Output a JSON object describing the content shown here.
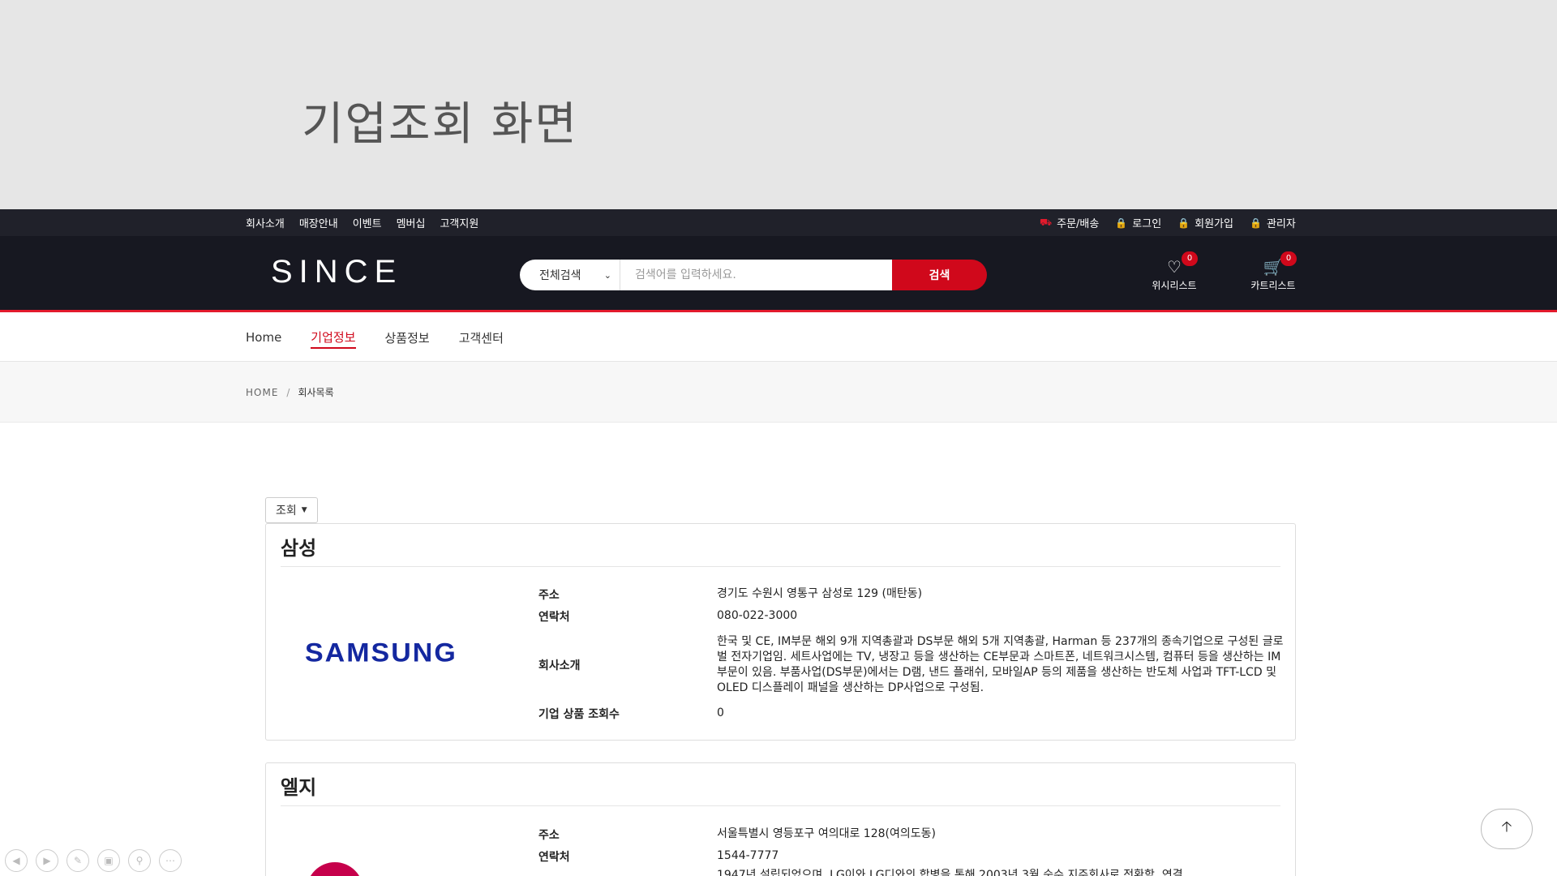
{
  "slide": {
    "title": "기업조회 화면"
  },
  "topbar": {
    "left_links": [
      "회사소개",
      "매장안내",
      "이벤트",
      "멤버십",
      "고객지원"
    ],
    "right_links": [
      {
        "label": "주문/배송",
        "icon": "truck-icon"
      },
      {
        "label": "로그인",
        "icon": "lock-icon"
      },
      {
        "label": "회원가입",
        "icon": "lock-icon"
      },
      {
        "label": "관리자",
        "icon": "lock-icon"
      }
    ]
  },
  "header": {
    "logo": "SINCE",
    "search": {
      "category": "전체검색",
      "placeholder": "검색어를 입력하세요.",
      "button": "검색"
    },
    "wishlist": {
      "label": "위시리스트",
      "count": "0",
      "icon": "heart-icon"
    },
    "cart": {
      "label": "카트리스트",
      "count": "0",
      "icon": "cart-icon"
    }
  },
  "mainnav": {
    "items": [
      "Home",
      "기업정보",
      "상품정보",
      "고객센터"
    ],
    "active": "기업정보"
  },
  "breadcrumb": {
    "home": "HOME",
    "sep": "/",
    "current": "회사목록"
  },
  "dropdown": {
    "label": "조회"
  },
  "companies": [
    {
      "name": "삼성",
      "logo_text": "SAMSUNG",
      "address_label": "주소",
      "address": "경기도 수원시 영통구 삼성로 129 (매탄동)",
      "phone_label": "연락처",
      "phone": "080-022-3000",
      "intro_label": "회사소개",
      "intro": "한국 및 CE, IM부문 해외 9개 지역총괄과 DS부문 해외 5개 지역총괄, Harman 등 237개의 종속기업으로 구성된 글로벌 전자기업임. 세트사업에는 TV, 냉장고 등을 생산하는 CE부문과 스마트폰, 네트워크시스템, 컴퓨터 등을 생산하는 IM부문이 있음. 부품사업(DS부문)에서는 D램, 낸드 플래쉬, 모바일AP 등의 제품을 생산하는 반도체 사업과 TFT-LCD 및 OLED 디스플레이 패널을 생산하는 DP사업으로 구성됨.",
      "views_label": "기업 상품 조회수",
      "views": "0"
    },
    {
      "name": "엘지",
      "address_label": "주소",
      "address": "서울특별시 영등포구 여의대로 128(여의도동)",
      "phone_label": "연락처",
      "phone": "1544-7777",
      "intro_partial": "1947년 설립되었으며, LG이와 LG디와의 합병을 통해 2003년 3월 순수 지주회사로 전환함. 연결"
    }
  ],
  "scroll_top": {
    "icon": "arrow-up-icon"
  },
  "presentation_controls": [
    "prev-icon",
    "next-icon",
    "pen-icon",
    "slides-icon",
    "zoom-icon",
    "more-icon"
  ]
}
